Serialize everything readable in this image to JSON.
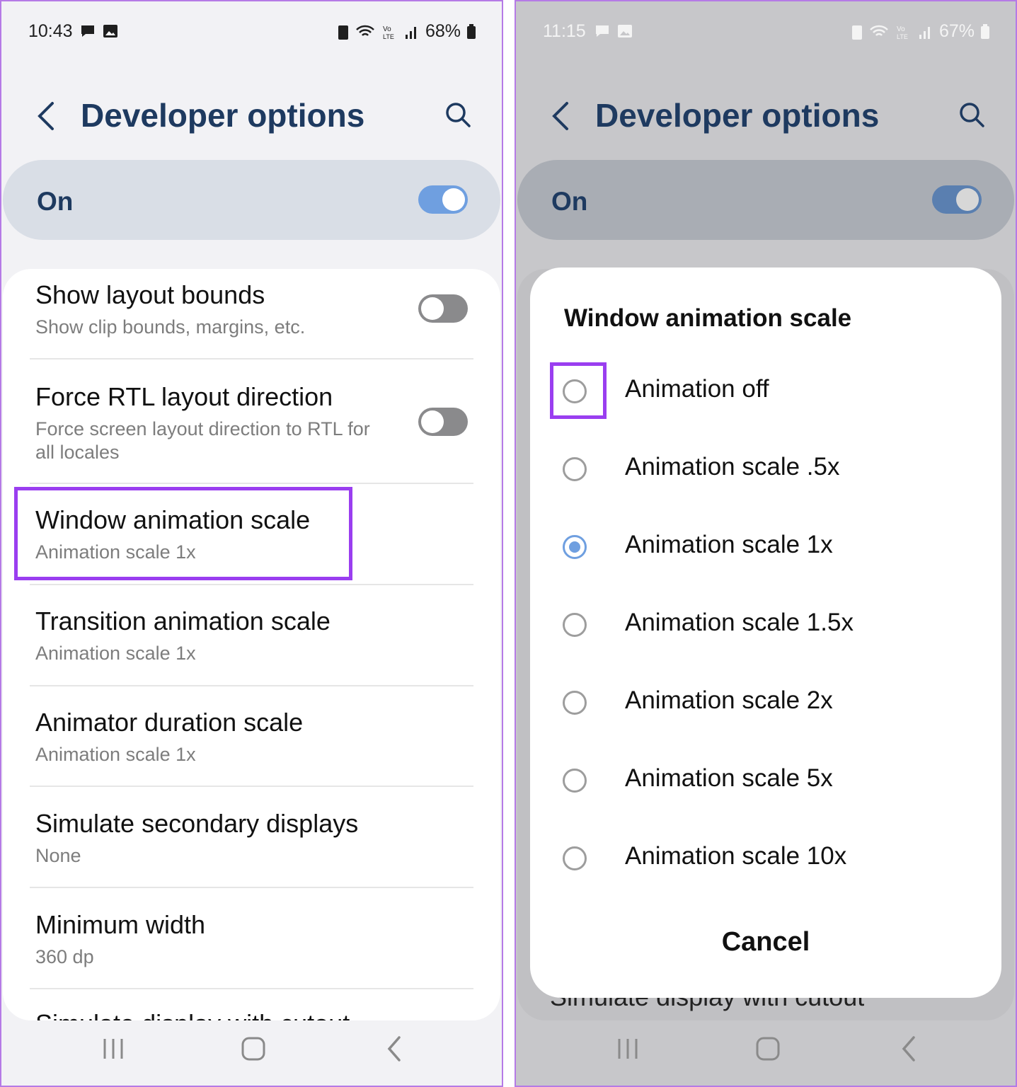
{
  "left": {
    "status": {
      "time": "10:43",
      "battery": "68%"
    },
    "header": {
      "title": "Developer options"
    },
    "master": {
      "label": "On",
      "enabled": true
    },
    "items": [
      {
        "title": "Show layout bounds",
        "subtitle": "Show clip bounds, margins, etc.",
        "toggle": false
      },
      {
        "title": "Force RTL layout direction",
        "subtitle": "Force screen layout direction to RTL for",
        "subtitle2": "all locales",
        "toggle": false
      },
      {
        "title": "Window animation scale",
        "subtitle": "Animation scale 1x"
      },
      {
        "title": "Transition animation scale",
        "subtitle": "Animation scale 1x"
      },
      {
        "title": "Animator duration scale",
        "subtitle": "Animation scale 1x"
      },
      {
        "title": "Simulate secondary displays",
        "subtitle": "None"
      },
      {
        "title": "Minimum width",
        "subtitle": "360 dp"
      },
      {
        "title": "Simulate display with cutout"
      }
    ]
  },
  "right": {
    "status": {
      "time": "11:15",
      "battery": "67%"
    },
    "header": {
      "title": "Developer options"
    },
    "master": {
      "label": "On",
      "enabled": true
    },
    "dialog": {
      "title": "Window animation scale",
      "options": [
        "Animation off",
        "Animation scale .5x",
        "Animation scale 1x",
        "Animation scale 1.5x",
        "Animation scale 2x",
        "Animation scale 5x",
        "Animation scale 10x"
      ],
      "selected_index": 2,
      "cancel_label": "Cancel"
    },
    "behind_text": "Simulate display with cutout"
  },
  "colors": {
    "accent": "#6f9fe0",
    "highlight": "#9a3ef0",
    "title": "#1e3a60"
  }
}
